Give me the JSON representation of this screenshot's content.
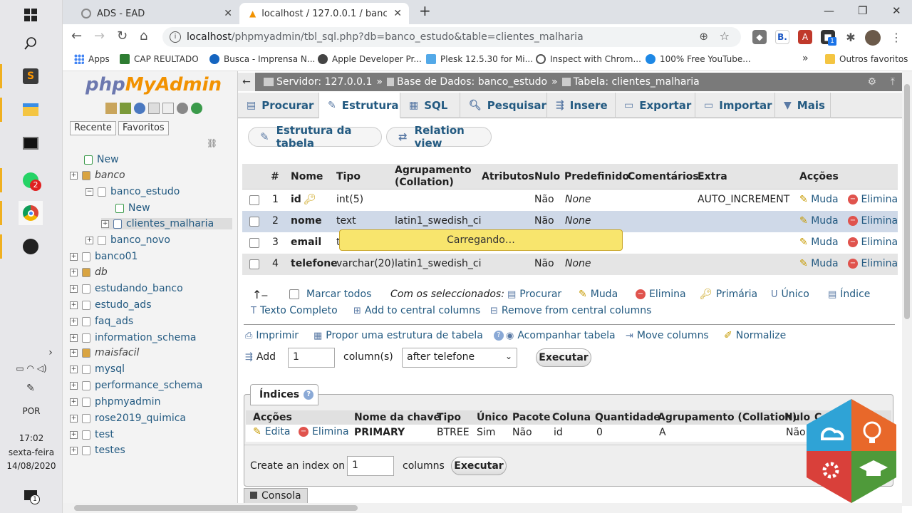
{
  "taskbar": {
    "whatsapp_badge": "2",
    "language": "POR",
    "time": "17:02",
    "weekday": "sexta-feira",
    "date": "14/08/2020",
    "notify_badge": "1"
  },
  "browser": {
    "tabs": [
      {
        "title": "ADS - EAD"
      },
      {
        "title": "localhost / 127.0.0.1 / banco_estu"
      }
    ],
    "new_tab": "+",
    "url_host": "localhost",
    "url_path": "/phpmyadmin/tbl_sql.php?db=banco_estudo&table=clientes_malharia",
    "bookmarks": [
      {
        "label": "Apps"
      },
      {
        "label": "CAP REULTADO"
      },
      {
        "label": "Busca - Imprensa N..."
      },
      {
        "label": "Apple Developer Pr..."
      },
      {
        "label": "Plesk 12.5.30 for Mi..."
      },
      {
        "label": "Inspect with Chrom..."
      },
      {
        "label": "100% Free YouTube..."
      }
    ],
    "bookmarks_more": "»",
    "other_bookmarks": "Outros favoritos",
    "ext_badge": "1"
  },
  "nav": {
    "logo_php": "php",
    "logo_myadmin": "MyAdmin",
    "tabs": [
      "Recente",
      "Favoritos"
    ],
    "tree": [
      {
        "label": "New",
        "italic": false
      },
      {
        "label": "banco",
        "italic": true
      },
      {
        "label": "banco_estudo",
        "italic": false
      },
      {
        "label": "New",
        "italic": false
      },
      {
        "label": "clientes_malharia",
        "italic": false
      },
      {
        "label": "banco_novo",
        "italic": false
      },
      {
        "label": "banco01",
        "italic": false
      },
      {
        "label": "db",
        "italic": true
      },
      {
        "label": "estudando_banco",
        "italic": false
      },
      {
        "label": "estudo_ads",
        "italic": false
      },
      {
        "label": "faq_ads",
        "italic": false
      },
      {
        "label": "information_schema",
        "italic": false
      },
      {
        "label": "maisfacil",
        "italic": true
      },
      {
        "label": "mysql",
        "italic": false
      },
      {
        "label": "performance_schema",
        "italic": false
      },
      {
        "label": "phpmyadmin",
        "italic": false
      },
      {
        "label": "rose2019_quimica",
        "italic": false
      },
      {
        "label": "test",
        "italic": false
      },
      {
        "label": "testes",
        "italic": false
      }
    ]
  },
  "breadcrumb": {
    "server": "Servidor: 127.0.0.1",
    "database": "Base de Dados: banco_estudo",
    "table": "Tabela: clientes_malharia",
    "sep": "»"
  },
  "topmenu": [
    "Procurar",
    "Estrutura",
    "SQL",
    "Pesquisar",
    "Insere",
    "Exportar",
    "Importar",
    "Mais"
  ],
  "subtabs": [
    "Estrutura da tabela",
    "Relation view"
  ],
  "structure": {
    "headers": [
      "#",
      "Nome",
      "Tipo",
      "Agrupamento (Collation)",
      "Atributos",
      "Nulo",
      "Predefinido",
      "Comentários",
      "Extra",
      "Acções"
    ],
    "rows": [
      {
        "num": "1",
        "name": "id",
        "type": "int(5)",
        "collation": "",
        "null": "Não",
        "default": "None",
        "extra": "AUTO_INCREMENT"
      },
      {
        "num": "2",
        "name": "nome",
        "type": "text",
        "collation": "latin1_swedish_ci",
        "null": "Não",
        "default": "None",
        "extra": ""
      },
      {
        "num": "3",
        "name": "email",
        "type": "t",
        "collation": "",
        "null": "",
        "default": "",
        "extra": ""
      },
      {
        "num": "4",
        "name": "telefone",
        "type": "varchar(20)",
        "collation": "latin1_swedish_ci",
        "null": "Não",
        "default": "None",
        "extra": ""
      }
    ],
    "action_change": "Muda",
    "action_drop": "Elimina",
    "loading": "Carregando…"
  },
  "bulk": {
    "check_all": "Marcar todos",
    "with_selected": "Com os seleccionados:",
    "actions": [
      "Procurar",
      "Muda",
      "Elimina",
      "Primária",
      "Único",
      "Índice"
    ],
    "actions2": [
      "Texto Completo",
      "Add to central columns",
      "Remove from central columns"
    ]
  },
  "tools": {
    "links": [
      "Imprimir",
      "Propor uma estrutura de tabela",
      "Acompanhar tabela",
      "Move columns",
      "Normalize"
    ],
    "add_label": "Add",
    "add_value": "1",
    "columns_label": "column(s)",
    "position": "after telefone",
    "execute": "Executar"
  },
  "indexes": {
    "title": "Índices",
    "headers": [
      "Acções",
      "Nome da chave",
      "Tipo",
      "Único",
      "Pacote",
      "Coluna",
      "Quantidade",
      "Agrupamento (Collation)",
      "Nulo",
      "Co"
    ],
    "row": {
      "edit": "Edita",
      "drop": "Elimina",
      "key": "PRIMARY",
      "type": "BTREE",
      "unique": "Sim",
      "packed": "Não",
      "column": "id",
      "cardinality": "0",
      "collation": "A",
      "null": "Não"
    },
    "create_label": "Create an index on",
    "create_value": "1",
    "create_columns": "columns",
    "execute": "Executar"
  },
  "console": "Consola"
}
